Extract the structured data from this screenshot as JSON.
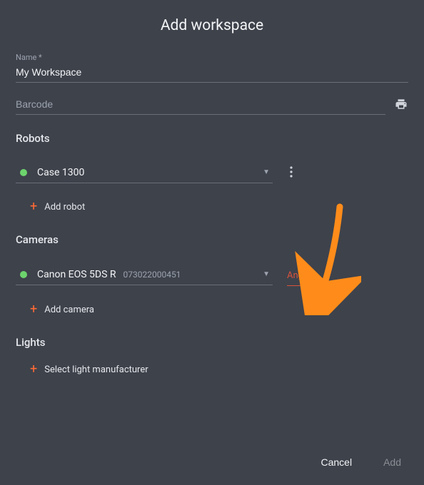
{
  "title": "Add workspace",
  "name": {
    "label": "Name *",
    "value": "My Workspace"
  },
  "barcode": {
    "placeholder": "Barcode"
  },
  "sections": {
    "robots": "Robots",
    "cameras": "Cameras",
    "lights": "Lights"
  },
  "robot": {
    "selected": "Case 1300"
  },
  "camera": {
    "selected": "Canon EOS 5DS R",
    "serial": "073022000451",
    "angle_label": "Angle *"
  },
  "actions": {
    "add_robot": "Add robot",
    "add_camera": "Add camera",
    "select_light": "Select light manufacturer"
  },
  "footer": {
    "cancel": "Cancel",
    "add": "Add"
  }
}
